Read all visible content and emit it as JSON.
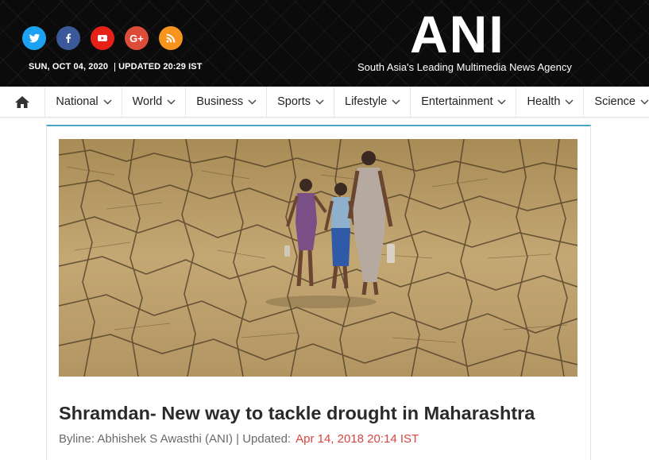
{
  "header": {
    "socials": [
      {
        "name": "twitter",
        "icon": "twitter-icon",
        "color": "#1da1f2"
      },
      {
        "name": "facebook",
        "icon": "facebook-icon",
        "color": "#3b5998"
      },
      {
        "name": "youtube",
        "icon": "youtube-icon",
        "color": "#e62117"
      },
      {
        "name": "google-plus",
        "icon": "google-plus-icon",
        "color": "#dd4b39"
      },
      {
        "name": "rss",
        "icon": "rss-icon",
        "color": "#f7941d"
      }
    ],
    "date": "SUN, OCT 04, 2020",
    "updated": "UPDATED 20:29 IST",
    "logo": "ANI",
    "tagline": "South Asia's Leading Multimedia News Agency"
  },
  "nav": {
    "home_icon": "home-icon",
    "items": [
      {
        "label": "National"
      },
      {
        "label": "World"
      },
      {
        "label": "Business"
      },
      {
        "label": "Sports"
      },
      {
        "label": "Lifestyle"
      },
      {
        "label": "Entertainment"
      },
      {
        "label": "Health"
      },
      {
        "label": "Science"
      }
    ]
  },
  "article": {
    "image_alt": "Drought-cracked earth with three people walking",
    "headline": "Shramdan- New way to tackle drought in Maharashtra",
    "byline_prefix": "Byline: Abhishek S Awasthi (ANI) | Updated:",
    "date": "Apr 14, 2018 20:14 IST"
  },
  "colors": {
    "accent_line": "#4aa3c8",
    "date_red": "#d64541"
  }
}
